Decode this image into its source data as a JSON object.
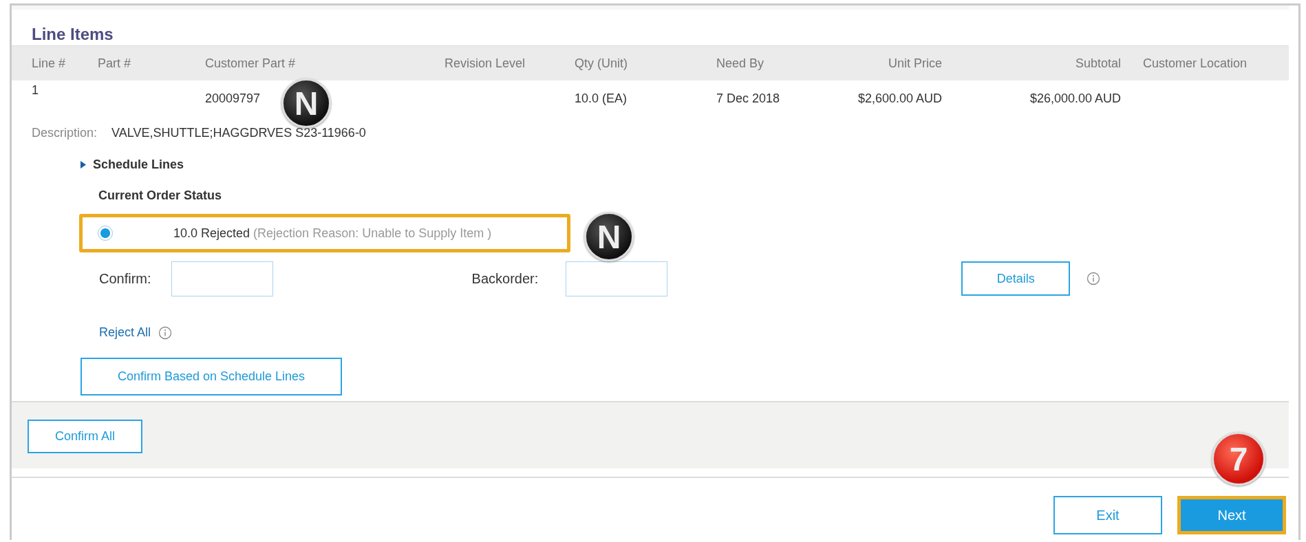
{
  "section": {
    "title": "Line Items"
  },
  "table": {
    "columns": [
      "Line #",
      "Part #",
      "Customer Part #",
      "Revision Level",
      "Qty (Unit)",
      "Need By",
      "Unit Price",
      "Subtotal",
      "Customer Location"
    ],
    "rows": [
      {
        "cells": [
          "1",
          "",
          "20009797",
          "",
          "10.0 (EA)",
          "7 Dec 2018",
          "$2,600.00 AUD",
          "$26,000.00 AUD",
          ""
        ],
        "description_label": "Description:",
        "description": "VALVE,SHUTTLE;HAGGDRVES S23-11966-0"
      }
    ]
  },
  "schedule_lines": {
    "label": "Schedule Lines",
    "expanded": false
  },
  "order_status": {
    "heading": "Current Order Status",
    "options": [
      {
        "status": "10.0 Rejected",
        "reason": "(Rejection Reason: Unable to Supply Item )",
        "selected": true,
        "highlighted": true
      }
    ]
  },
  "confirm_field": {
    "label": "Confirm:"
  },
  "backorder_field": {
    "label": "Backorder:"
  },
  "details_button": {
    "label": "Details"
  },
  "reject_all_link": {
    "label": "Reject All"
  },
  "confirm_schedule_button": {
    "label": "Confirm Based on Schedule Lines"
  },
  "confirm_all_button": {
    "label": "Confirm All"
  },
  "footer_buttons": [
    {
      "label": "Exit",
      "kind": "secondary",
      "highlighted": false
    },
    {
      "label": "Next",
      "kind": "primary",
      "highlighted": true
    }
  ],
  "annotations": [
    {
      "text": "N",
      "kind": "dark"
    },
    {
      "text": "N",
      "kind": "dark"
    },
    {
      "text": "7",
      "kind": "red"
    }
  ]
}
